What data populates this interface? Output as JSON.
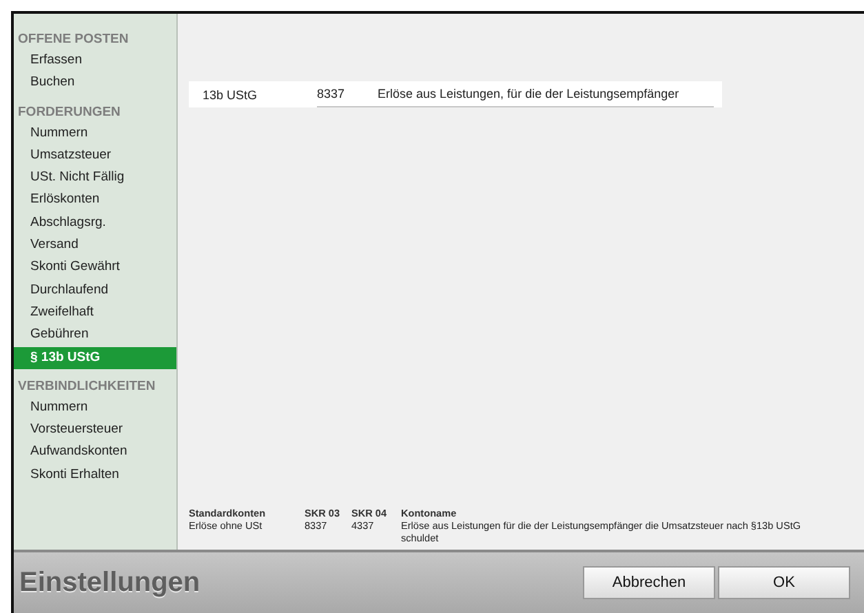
{
  "sidebar": {
    "sections": [
      {
        "title": "OFFENE POSTEN",
        "items": [
          {
            "label": "Erfassen",
            "selected": false
          },
          {
            "label": "Buchen",
            "selected": false
          }
        ]
      },
      {
        "title": "FORDERUNGEN",
        "items": [
          {
            "label": "Nummern",
            "selected": false
          },
          {
            "label": "Umsatzsteuer",
            "selected": false
          },
          {
            "label": "USt. Nicht Fällig",
            "selected": false
          },
          {
            "label": "Erlöskonten",
            "selected": false
          },
          {
            "label": "Abschlagsrg.",
            "selected": false
          },
          {
            "label": "Versand",
            "selected": false
          },
          {
            "label": "Skonti Gewährt",
            "selected": false
          },
          {
            "label": "Durchlaufend",
            "selected": false
          },
          {
            "label": "Zweifelhaft",
            "selected": false
          },
          {
            "label": "Gebühren",
            "selected": false
          },
          {
            "label": "§ 13b UStG",
            "selected": true
          }
        ]
      },
      {
        "title": "VERBINDLICHKEITEN",
        "items": [
          {
            "label": "Nummern",
            "selected": false
          },
          {
            "label": "Vorsteuersteuer",
            "selected": false
          },
          {
            "label": "Aufwandskonten",
            "selected": false
          },
          {
            "label": "Skonti Erhalten",
            "selected": false
          }
        ]
      }
    ]
  },
  "account_row": {
    "label": "13b UStG",
    "number": "8337",
    "description": "Erlöse aus Leistungen, für die der Leistungsempfänger"
  },
  "info": {
    "headers": [
      "Standardkonten",
      "SKR 03",
      "SKR 04",
      "Kontoname"
    ],
    "values": [
      "Erlöse ohne USt",
      "8337",
      "4337",
      "Erlöse aus Leistungen für die der Leistungsempfänger die Umsatzsteuer nach §13b UStG schuldet"
    ]
  },
  "footer": {
    "title": "Einstellungen",
    "buttons": [
      "Abbrechen",
      "OK"
    ]
  }
}
